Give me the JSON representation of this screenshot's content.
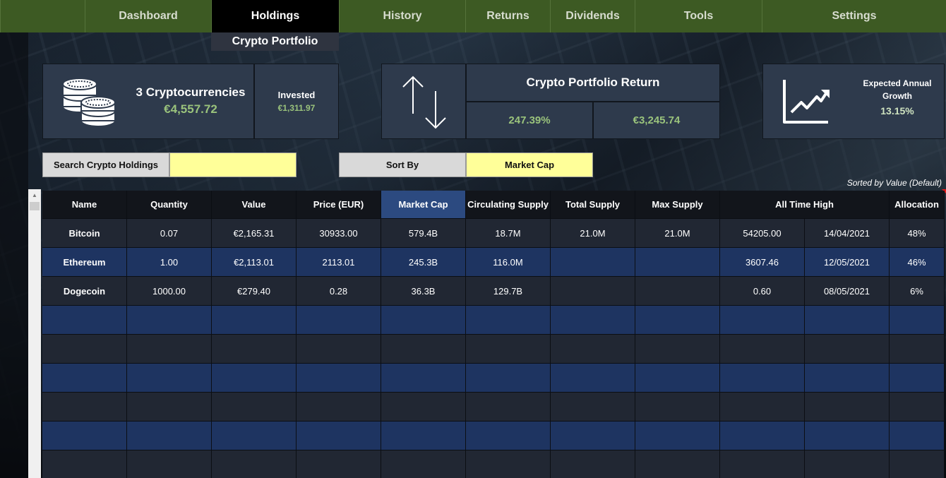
{
  "nav": {
    "tabs": [
      {
        "label": "Dashboard"
      },
      {
        "label": "Holdings"
      },
      {
        "label": "History"
      },
      {
        "label": "Returns"
      },
      {
        "label": "Dividends"
      },
      {
        "label": "Tools"
      },
      {
        "label": "Settings"
      }
    ],
    "active": "Holdings",
    "sub_label": "Crypto Portfolio"
  },
  "summary": {
    "count_label": "3 Cryptocurrencies",
    "total_value": "€4,557.72",
    "invested_label": "Invested",
    "invested_value": "€1,311.97",
    "return_title": "Crypto Portfolio Return",
    "return_pct": "247.39%",
    "return_value": "€3,245.74",
    "growth_label": "Expected Annual Growth",
    "growth_value": "13.15%"
  },
  "controls": {
    "search_label": "Search Crypto Holdings",
    "search_value": "",
    "sort_label": "Sort By",
    "sort_value": "Market Cap",
    "sorted_note": "Sorted by Value (Default)"
  },
  "table": {
    "headers": [
      "Name",
      "Quantity",
      "Value",
      "Price (EUR)",
      "Market Cap",
      "Circulating Supply",
      "Total Supply",
      "Max Supply",
      "All Time High",
      "Allocation"
    ],
    "rows": [
      {
        "name": "Bitcoin",
        "quantity": "0.07",
        "value": "€2,165.31",
        "price": "30933.00",
        "market_cap": "579.4B",
        "circ_supply": "18.7M",
        "total_supply": "21.0M",
        "max_supply": "21.0M",
        "ath_price": "54205.00",
        "ath_date": "14/04/2021",
        "allocation": "48%"
      },
      {
        "name": "Ethereum",
        "quantity": "1.00",
        "value": "€2,113.01",
        "price": "2113.01",
        "market_cap": "245.3B",
        "circ_supply": "116.0M",
        "total_supply": "",
        "max_supply": "",
        "ath_price": "3607.46",
        "ath_date": "12/05/2021",
        "allocation": "46%"
      },
      {
        "name": "Dogecoin",
        "quantity": "1000.00",
        "value": "€279.40",
        "price": "0.28",
        "market_cap": "36.3B",
        "circ_supply": "129.7B",
        "total_supply": "",
        "max_supply": "",
        "ath_price": "0.60",
        "ath_date": "08/05/2021",
        "allocation": "6%"
      }
    ]
  },
  "colors": {
    "nav_green": "#3d5a23",
    "card_bg": "#2e3a4c",
    "value_green": "#9ac37c",
    "row_blue": "#1e3461",
    "row_dark": "#212733",
    "highlight_yellow": "#ffff99",
    "market_cap_header": "#2c4a80"
  },
  "icons": {
    "coins": "coins-icon",
    "arrows": "up-down-arrows-icon",
    "chart": "growth-chart-icon"
  }
}
